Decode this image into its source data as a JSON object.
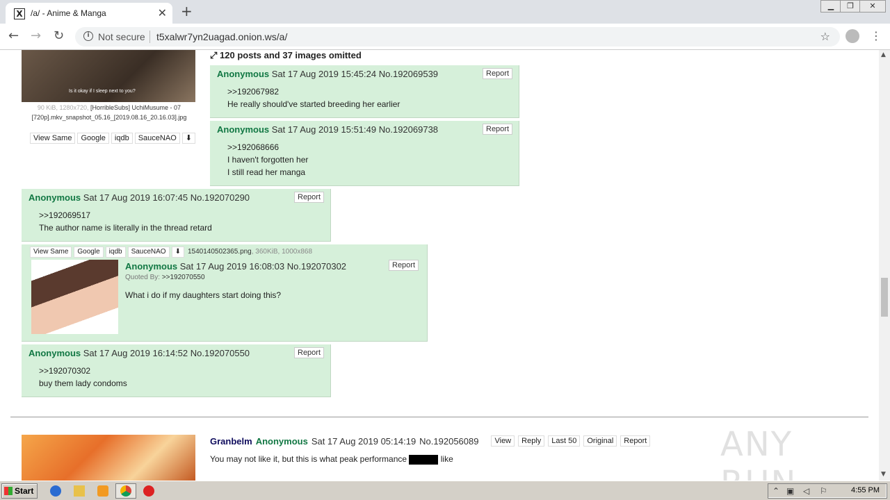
{
  "browser": {
    "tab_title": "/a/ - Anime & Manga",
    "favicon": "X",
    "new_tab": "+",
    "not_secure": "Not secure",
    "url": "t5xalwr7yn2uagad.onion.ws/a/"
  },
  "op": {
    "image_caption": "Is it okay if I sleep next to you?",
    "file_meta": "90 KiB, 1280x720,",
    "file_name": "[HorribleSubs] UchiMusume - 07 [720p].mkv_snapshot_05.16_[2019.08.16_20.16.03].jpg",
    "buttons": [
      "View Same",
      "Google",
      "iqdb",
      "SauceNAO"
    ],
    "omitted": "120 posts and 37 images omitted"
  },
  "posts": [
    {
      "name": "Anonymous",
      "date": "Sat 17 Aug 2019 15:45:24",
      "no": "No.192069539",
      "report": "Report",
      "lines": [
        ">>192067982",
        "He really should've started breeding her earlier"
      ]
    },
    {
      "name": "Anonymous",
      "date": "Sat 17 Aug 2019 15:51:49",
      "no": "No.192069738",
      "report": "Report",
      "lines": [
        ">>192068666",
        "I haven't forgotten her",
        "I still read her manga"
      ]
    },
    {
      "name": "Anonymous",
      "date": "Sat 17 Aug 2019 16:07:45",
      "no": "No.192070290",
      "report": "Report",
      "lines": [
        ">>192069517",
        "The author name is literally in the thread retard"
      ]
    },
    {
      "name": "Anonymous",
      "date": "Sat 17 Aug 2019 16:08:03",
      "no": "No.192070302",
      "report": "Report",
      "quoted_by_label": "Quoted By:",
      "quoted_by": ">>192070550",
      "file_buttons": [
        "View Same",
        "Google",
        "iqdb",
        "SauceNAO"
      ],
      "file_name": "1540140502365.png",
      "file_meta": ", 360KiB, 1000x868",
      "lines": [
        "What i do if my daughters start doing this?"
      ]
    },
    {
      "name": "Anonymous",
      "date": "Sat 17 Aug 2019 16:14:52",
      "no": "No.192070550",
      "report": "Report",
      "lines": [
        ">>192070302",
        "buy them lady condoms"
      ]
    }
  ],
  "thread2": {
    "subject": "Granbelm",
    "name": "Anonymous",
    "date": "Sat 17 Aug 2019 05:14:19",
    "no": "No.192056089",
    "buttons": [
      "View",
      "Reply",
      "Last 50",
      "Original",
      "Report"
    ],
    "text_before": "You may not like it, but this is what peak performance",
    "text_after": "like"
  },
  "watermark": "ANY RUN",
  "taskbar": {
    "start": "Start",
    "clock": "4:55 PM"
  },
  "icons": [
    "x-favicon-icon",
    "close-icon",
    "plus-icon",
    "back-icon",
    "forward-icon",
    "reload-icon",
    "info-icon",
    "star-icon",
    "avatar-icon",
    "menu-icon",
    "expand-icon",
    "download-icon"
  ]
}
